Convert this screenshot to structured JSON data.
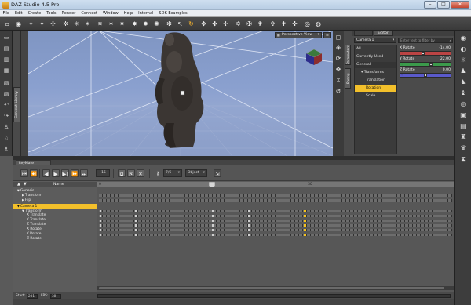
{
  "app": {
    "title": "DAZ Studio 4.5 Pro"
  },
  "window_controls": {
    "minimize": "–",
    "maximize": "□",
    "close": "✕"
  },
  "menu": [
    "File",
    "Edit",
    "Create",
    "Tools",
    "Render",
    "Connect",
    "Window",
    "Help",
    "Internal",
    "SDK Examples"
  ],
  "viewport": {
    "view_label": "Perspective View"
  },
  "panel": {
    "tabs": [
      "",
      "Editor"
    ],
    "camera_select": "Camera 1",
    "search_placeholder": "Enter text to filter by",
    "categories": [
      {
        "label": "All",
        "indent": 0,
        "state": "normal"
      },
      {
        "label": "Currently Used",
        "indent": 0,
        "state": "normal"
      },
      {
        "label": "General",
        "indent": 0,
        "state": "normal"
      },
      {
        "label": "Transforms",
        "indent": 1,
        "state": "normal"
      },
      {
        "label": "Translation",
        "indent": 2,
        "state": "normal"
      },
      {
        "label": "Rotation",
        "indent": 2,
        "state": "selected"
      },
      {
        "label": "Scale",
        "indent": 2,
        "state": "normal"
      }
    ],
    "params": [
      {
        "label": "X Rotate",
        "value": "-14.00",
        "fill_fraction": 0.45,
        "bar_color": "#b44"
      },
      {
        "label": "Y Rotate",
        "value": "22.00",
        "fill_fraction": 0.62,
        "bar_color": "#3b9a4b"
      },
      {
        "label": "Z Rotate",
        "value": "0.00",
        "fill_fraction": 0.5,
        "bar_color": "#5a5acb"
      }
    ],
    "side_tabs": [
      "Parameters",
      "Posing"
    ]
  },
  "left_tab": "Content Library",
  "keymate": {
    "tab_label": "keyMate",
    "controls": {
      "fps_field": "15",
      "range_field": "7/6",
      "mode_select": "Object"
    },
    "name_header": "Name",
    "ruler_start": "0",
    "ruler_mid": "30",
    "tree": [
      {
        "label": "Genesis",
        "indent": 0,
        "arrow": "▼",
        "selected": false
      },
      {
        "label": "Transform",
        "indent": 1,
        "arrow": "▶",
        "selected": false
      },
      {
        "label": "Hip",
        "indent": 1,
        "arrow": "▶",
        "selected": false
      },
      {
        "label": "Camera 1",
        "indent": 0,
        "arrow": "▼",
        "selected": true
      },
      {
        "label": "Transform",
        "indent": 1,
        "arrow": "▼",
        "selected": false
      },
      {
        "label": "X Translate",
        "indent": 2,
        "arrow": "",
        "selected": false
      },
      {
        "label": "Y Translate",
        "indent": 2,
        "arrow": "",
        "selected": false
      },
      {
        "label": "Z Translate",
        "indent": 2,
        "arrow": "",
        "selected": false
      },
      {
        "label": "X Rotate",
        "indent": 2,
        "arrow": "",
        "selected": false
      },
      {
        "label": "Y Rotate",
        "indent": 2,
        "arrow": "",
        "selected": false
      },
      {
        "label": "Z Rotate",
        "indent": 2,
        "arrow": "",
        "selected": false
      }
    ],
    "status": {
      "start_label": "Start:",
      "start_value": "201",
      "fps_label": "FPS:",
      "fps_value": "30"
    }
  },
  "colors": {
    "accent": "#f3c02b",
    "viewport_bg": "#8a9fcd"
  }
}
